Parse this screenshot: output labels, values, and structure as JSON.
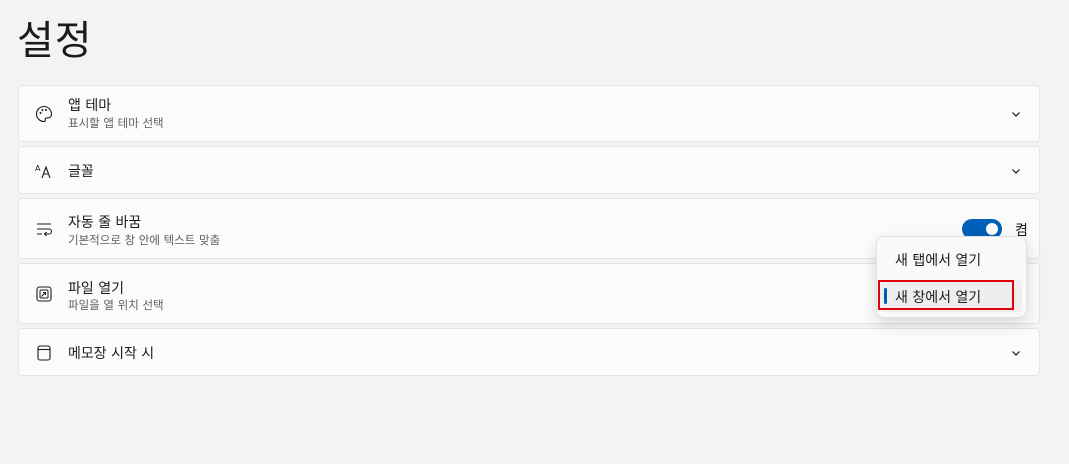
{
  "page": {
    "title": "설정"
  },
  "settings": [
    {
      "id": "app-theme",
      "title": "앱 테마",
      "description": "표시할 앱 테마 선택",
      "icon": "palette-icon",
      "control": "chevron-down-icon"
    },
    {
      "id": "font",
      "title": "글꼴",
      "icon": "font-icon",
      "control": "chevron-down-icon"
    },
    {
      "id": "word-wrap",
      "title": "자동 줄 바꿈",
      "description": "기본적으로 창 안에 텍스트 맞춤",
      "icon": "word-wrap-icon",
      "control": "toggle",
      "toggle": {
        "on": true,
        "label": "켬"
      }
    },
    {
      "id": "open-files",
      "title": "파일 열기",
      "description": "파일을 열 위치 선택",
      "icon": "open-file-icon",
      "control": "dropdown"
    },
    {
      "id": "notepad-start",
      "title": "메모장 시작 시",
      "icon": "notepad-icon",
      "control": "chevron-down-icon"
    }
  ],
  "open_files_menu": {
    "options": [
      "새 탭에서 열기",
      "새 창에서 열기"
    ],
    "selected": "새 창에서 열기"
  },
  "colors": {
    "accent": "#005fb8",
    "highlight": "#e0000b",
    "background": "#f3f3f3",
    "card": "#fbfbfb"
  }
}
